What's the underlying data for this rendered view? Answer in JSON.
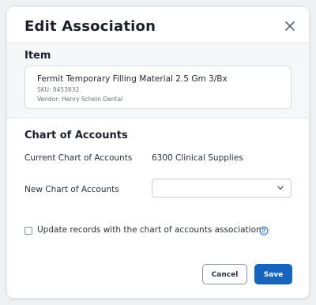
{
  "dialog": {
    "title": "Edit Association"
  },
  "item": {
    "section_title": "Item",
    "name": "Fermit Temporary Filling Material 2.5 Gm 3/Bx",
    "sku": "SKU: 9453832",
    "vendor": "Vendor: Henry Schein Dental"
  },
  "chart_of_accounts": {
    "section_title": "Chart of Accounts",
    "current_label": "Current Chart of Accounts",
    "current_value": "6300 Clinical Supplies",
    "new_label": "New Chart of Accounts",
    "new_value": ""
  },
  "update_checkbox": {
    "label": "Update records with the chart of accounts association.",
    "checked": false
  },
  "actions": {
    "cancel_label": "Cancel",
    "save_label": "Save"
  },
  "colors": {
    "primary": "#1565c0",
    "background": "#f0f1f3",
    "section_bg": "#f6f7f9"
  },
  "icons": {
    "close": "close-icon",
    "dropdown": "chevron-down-icon",
    "help": "help-circle-icon"
  }
}
